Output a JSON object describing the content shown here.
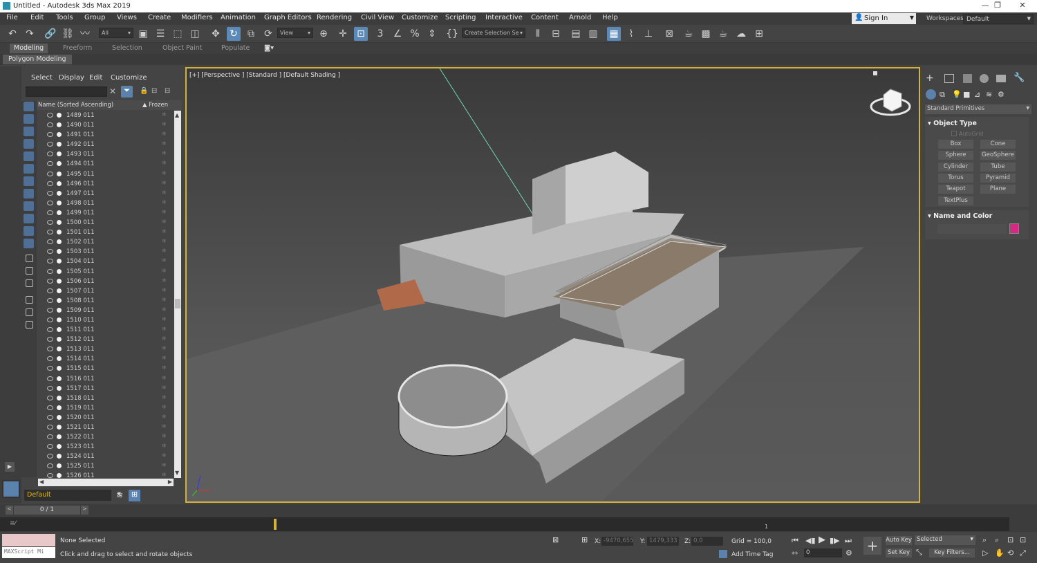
{
  "app": {
    "title": "Untitled - Autodesk 3ds Max 2019",
    "window_controls": [
      "—",
      "❐",
      "✕"
    ]
  },
  "menu": [
    "File",
    "Edit",
    "Tools",
    "Group",
    "Views",
    "Create",
    "Modifiers",
    "Animation",
    "Graph Editors",
    "Rendering",
    "Civil View",
    "Customize",
    "Scripting",
    "Interactive",
    "Content",
    "Arnold",
    "Help"
  ],
  "account": {
    "signin_label": "Sign In",
    "workspaces_label": "Workspaces:",
    "workspace_value": "Default"
  },
  "toolbar": {
    "filter_value": "All",
    "refcoord_value": "View",
    "selection_set_value": "Create Selection Se"
  },
  "ribbon": {
    "tabs": [
      "Modeling",
      "Freeform",
      "Selection",
      "Object Paint",
      "Populate"
    ],
    "active_panel": "Polygon Modeling"
  },
  "scene_explorer": {
    "menus": [
      "Select",
      "Display",
      "Edit",
      "Customize"
    ],
    "col_name": "Name (Sorted Ascending)",
    "col_frozen": "▲ Frozen",
    "rows": [
      "1489   011",
      "1490   011",
      "1491   011",
      "1492   011",
      "1493   011",
      "1494   011",
      "1495   011",
      "1496   011",
      "1497   011",
      "1498   011",
      "1499   011",
      "1500   011",
      "1501   011",
      "1502   011",
      "1503   011",
      "1504   011",
      "1505   011",
      "1506   011",
      "1507   011",
      "1508   011",
      "1509   011",
      "1510   011",
      "1511   011",
      "1512   011",
      "1513   011",
      "1514   011",
      "1515   011",
      "1516   011",
      "1517   011",
      "1518   011",
      "1519   011",
      "1520   011",
      "1521   011",
      "1522   011",
      "1523   011",
      "1524   011",
      "1525   011",
      "1526   011"
    ],
    "layer_value": "Default"
  },
  "viewport": {
    "label": "[+] [Perspective ] [Standard ] [Default Shading ]"
  },
  "command_panel": {
    "category_value": "Standard Primitives",
    "object_type_title": "Object Type",
    "autogrid_label": "AutoGrid",
    "buttons": [
      "Box",
      "Cone",
      "Sphere",
      "GeoSphere",
      "Cylinder",
      "Tube",
      "Torus",
      "Pyramid",
      "Teapot",
      "Plane",
      "TextPlus"
    ],
    "name_color_title": "Name and Color",
    "object_color": "#d42a84"
  },
  "timeline": {
    "frame_counter": "0 / 1",
    "tick_mark": "1"
  },
  "status": {
    "maxscript_label": "MAXScript Mi",
    "selection_text": "None Selected",
    "prompt_text": "Click and drag to select and rotate objects",
    "x_label": "X:",
    "x_value": "-9470,655",
    "y_label": "Y:",
    "y_value": "1479,333",
    "z_label": "Z:",
    "z_value": "0,0",
    "grid_text": "Grid = 100,0",
    "add_time_tag": "Add Time Tag",
    "auto_key": "Auto Key",
    "set_key": "Set Key",
    "key_mode_value": "Selected",
    "key_filters": "Key Filters...",
    "frame_value": "0"
  }
}
